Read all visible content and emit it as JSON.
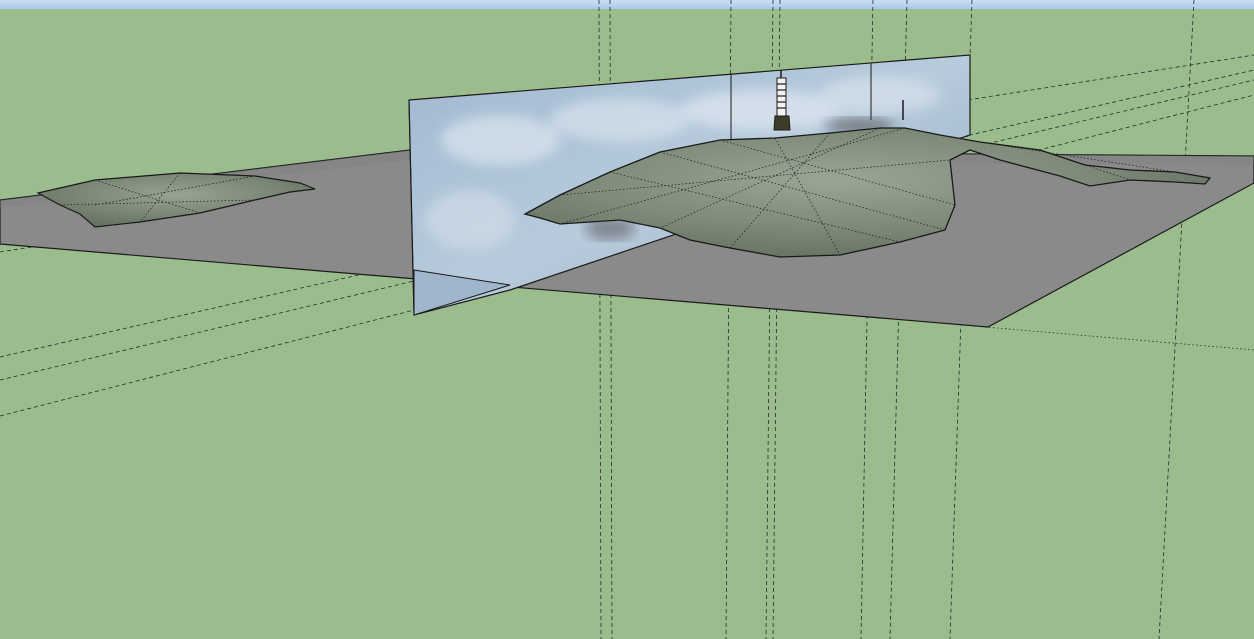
{
  "app": {
    "view": "3d-modeling-viewport"
  },
  "scene": {
    "colors": {
      "sky": "#b4d2f0",
      "ground": "#9bbd8d",
      "ground_plane": "#8a8a8a",
      "backdrop_panel": "#a9bdcf",
      "terrain": "#8a9686",
      "terrain_dark": "#5c6a58",
      "edge": "#1a1a1a"
    },
    "icons": {
      "tower": "antenna-tower-icon"
    }
  }
}
